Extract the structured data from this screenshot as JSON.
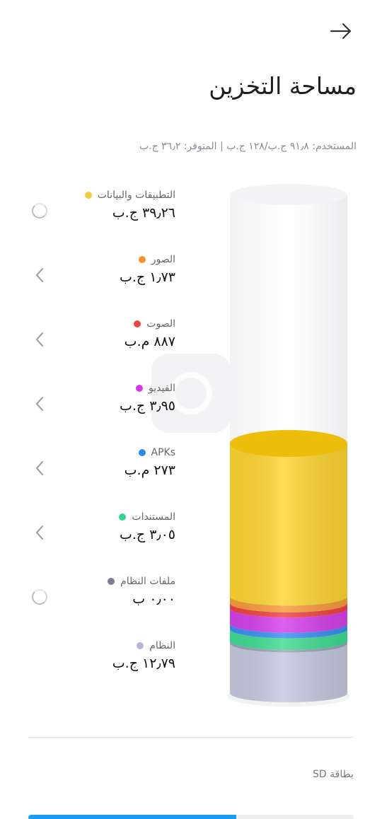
{
  "header": {
    "back_icon": "arrow-right-icon",
    "title": "مساحة التخزين"
  },
  "summary": "المستخدم: ٩١٫٨ ج.ب/١٢٨ ج.ب | المتوفر: ٣٦٫٢ ج.ب",
  "categories": [
    {
      "label": "التطبيقات والبيانات",
      "size": "٣٩٫٢٦ ج.ب",
      "color": "#f6c945",
      "action": "spinner"
    },
    {
      "label": "الصور",
      "size": "١٫٧٣ ج.ب",
      "color": "#f7932e",
      "action": "chevron-left-icon"
    },
    {
      "label": "الصوت",
      "size": "٨٨٧ م.ب",
      "color": "#f04545",
      "action": "chevron-left-icon"
    },
    {
      "label": "الفيديو",
      "size": "٣٫٩٥ ج.ب",
      "color": "#d63be8",
      "action": "chevron-left-icon"
    },
    {
      "label": "APKs",
      "size": "٢٧٣ م.ب",
      "color": "#2f86ee",
      "action": "chevron-left-icon"
    },
    {
      "label": "المستندات",
      "size": "٣٫٠٥ ج.ب",
      "color": "#34d58f",
      "action": "chevron-left-icon"
    },
    {
      "label": "ملفات النظام",
      "size": "٠٫٠٠ ب",
      "color": "#7d7f98",
      "action": "spinner"
    },
    {
      "label": "النظام",
      "size": "١٢٫٧٩ ج.ب",
      "color": "#b3b5d6",
      "action": "none"
    }
  ],
  "storage": {
    "total_gb": 128,
    "segments": [
      {
        "name": "النظام",
        "gb": 12.79,
        "color": "#c5c7de"
      },
      {
        "name": "ملفات النظام",
        "gb": 0.6,
        "color": "#9da0b8"
      },
      {
        "name": "المستندات",
        "gb": 3.05,
        "color": "#3fdb92"
      },
      {
        "name": "APKs",
        "gb": 1.4,
        "color": "#3a8ef2"
      },
      {
        "name": "الفيديو",
        "gb": 3.95,
        "color": "#d440ea"
      },
      {
        "name": "الصوت",
        "gb": 1.3,
        "color": "#f04040"
      },
      {
        "name": "الصور",
        "gb": 1.73,
        "color": "#f79a3a"
      },
      {
        "name": "التطبيقات والبيانات",
        "gb": 39.26,
        "color": "#fdd531"
      }
    ]
  },
  "sd_card": {
    "label": "بطاقة SD",
    "used_fraction": 0.64,
    "color": "#1a9cf0"
  }
}
